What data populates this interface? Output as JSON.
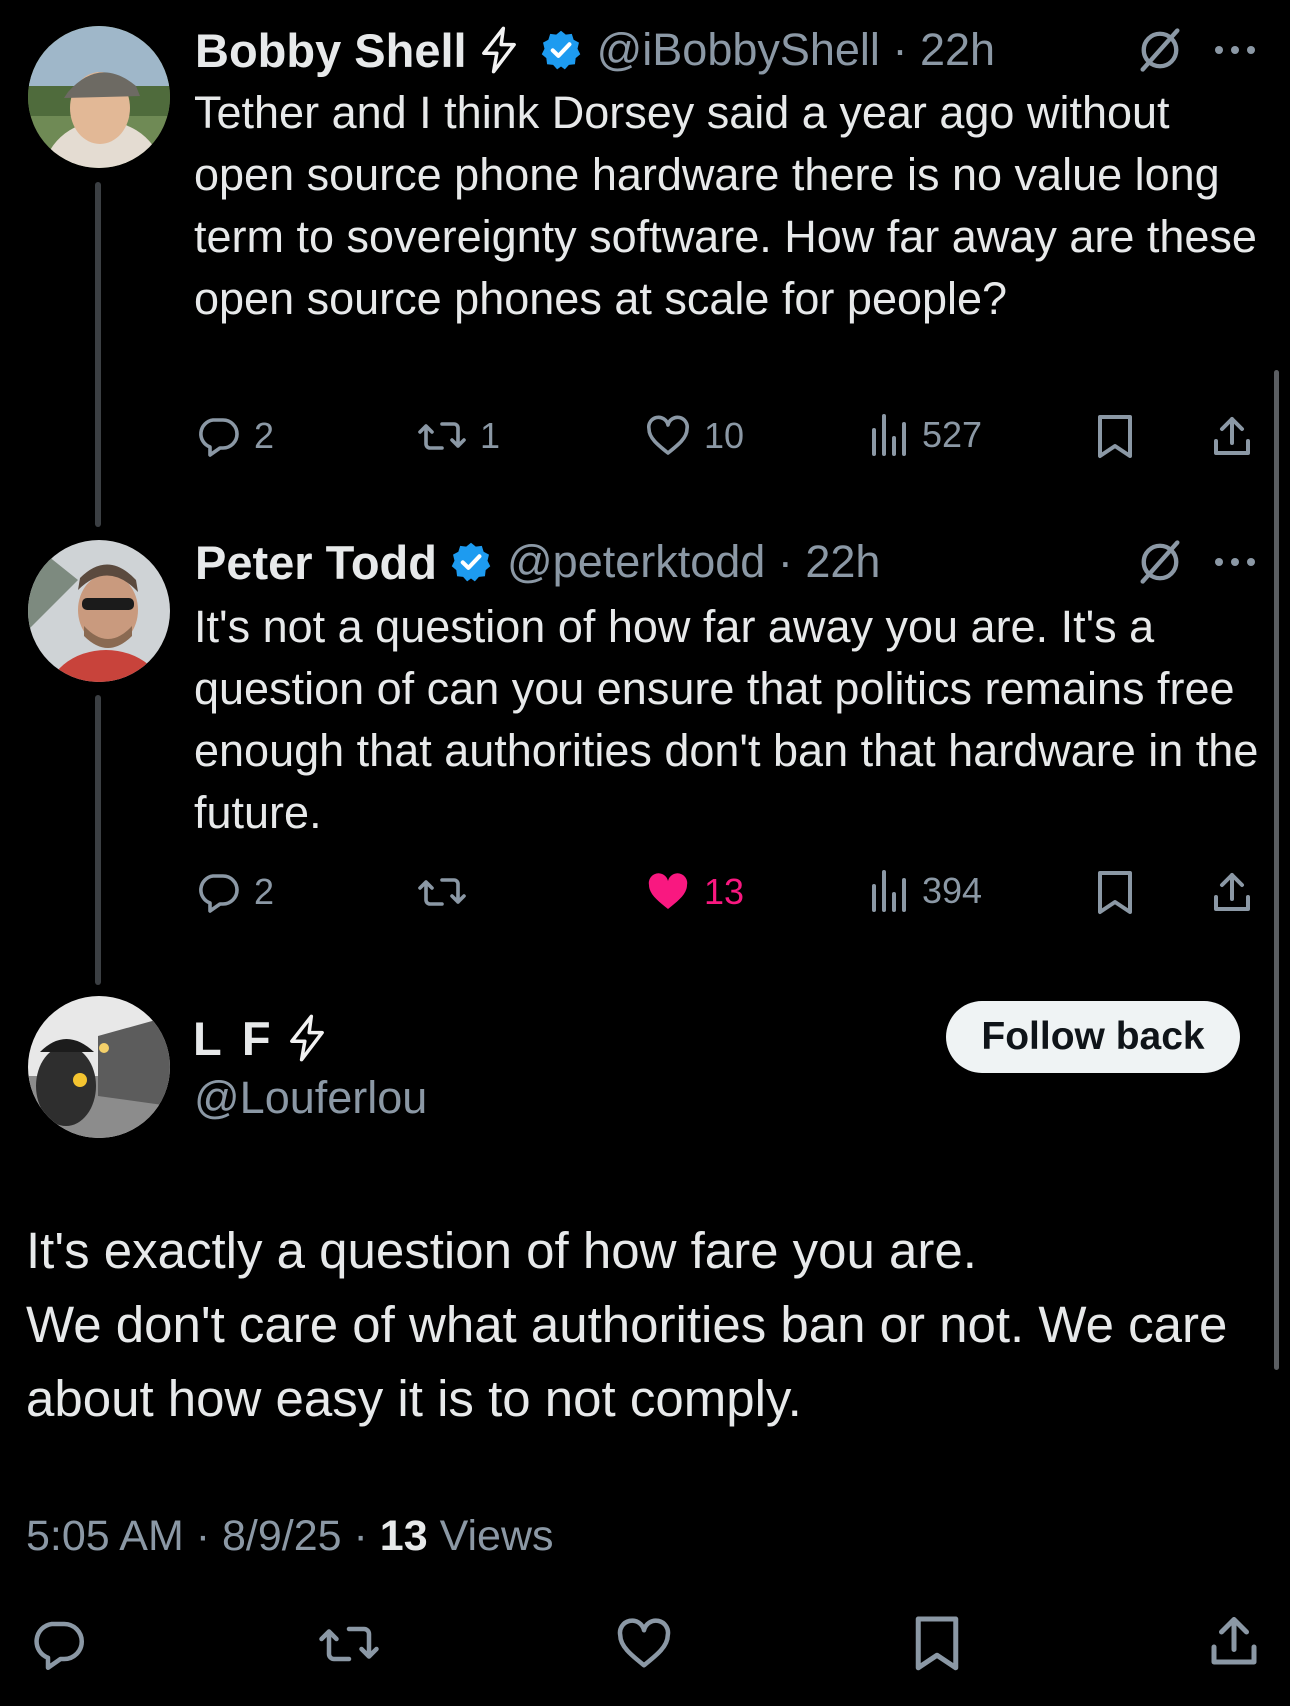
{
  "tweets": [
    {
      "name": "Bobby Shell",
      "handle": "@iBobbyShell",
      "time": "22h",
      "text": "Tether and I think Dorsey said a year ago without open source phone hardware there is no value long term to sovereignty software. How far away are these open source phones at scale for people?",
      "replies": "2",
      "reposts": "1",
      "likes": "10",
      "views": "527",
      "liked": false
    },
    {
      "name": "Peter Todd",
      "handle": "@peterktodd",
      "time": "22h",
      "text": "It's not a question of how far away you are. It's a question of can you ensure that politics remains free enough that authorities don't ban that hardware in the future.",
      "replies": "2",
      "reposts": "",
      "likes": "13",
      "views": "394",
      "liked": true
    }
  ],
  "main_tweet": {
    "name": "L F",
    "handle": "@Louferlou",
    "follow_label": "Follow back",
    "text": "It's exactly a question of how fare  you are.\nWe don't care of what authorities ban or  not. We care about how easy it is to not comply.",
    "time": "5:05 AM",
    "date": "8/9/25",
    "views_count": "13",
    "views_label": "Views"
  },
  "colors": {
    "background": "#000000",
    "text": "#e7e9ea",
    "secondary": "#8b98a5",
    "verified": "#1d9bf0",
    "like_active": "#f91880",
    "lightning": "#f2f2f2"
  },
  "icons": [
    "lightning-icon",
    "verified-badge-icon",
    "grok-icon",
    "more-icon",
    "reply-icon",
    "repost-icon",
    "like-icon",
    "views-icon",
    "bookmark-icon",
    "share-icon"
  ]
}
